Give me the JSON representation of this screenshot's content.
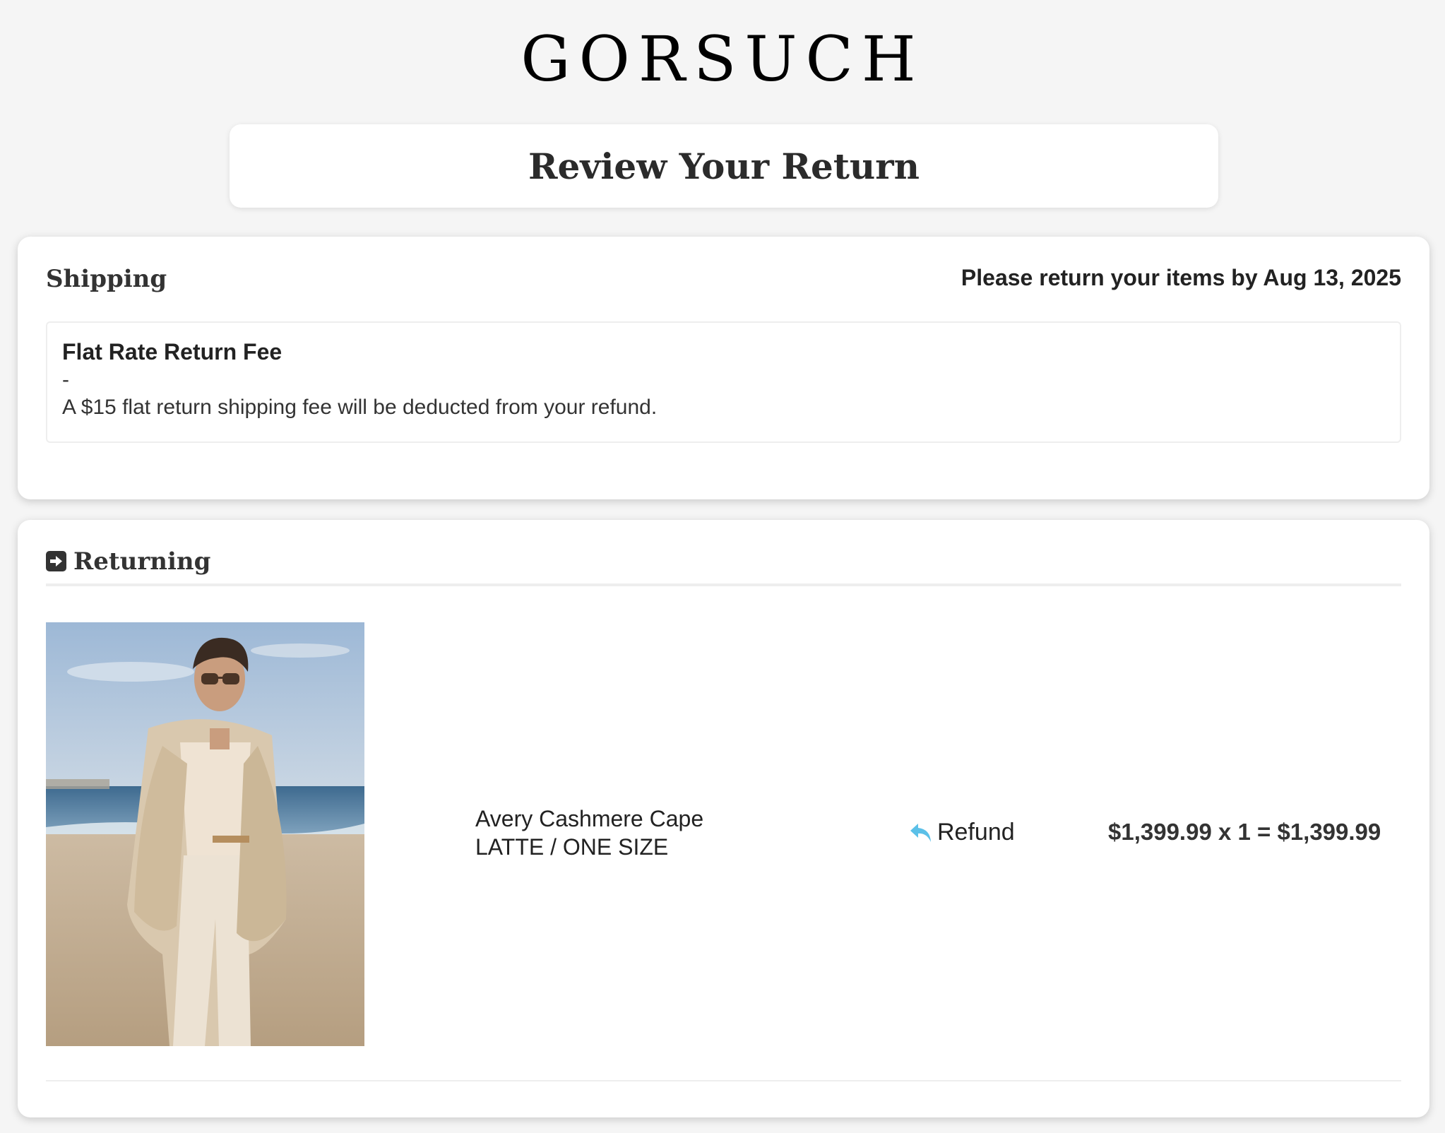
{
  "brand": {
    "logo_text": "GORSUCH"
  },
  "page": {
    "title": "Review Your Return"
  },
  "shipping": {
    "title": "Shipping",
    "return_by": "Please return your items by Aug 13, 2025",
    "fee": {
      "name": "Flat Rate Return Fee",
      "separator": "-",
      "description": "A $15 flat return shipping fee will be deducted from your refund."
    }
  },
  "returning": {
    "title": "Returning",
    "icon": "sign-in-icon",
    "items": [
      {
        "name": "Avery Cashmere Cape",
        "variant": "LATTE / ONE SIZE",
        "action_icon": "reply-icon",
        "action_label": "Refund",
        "price_line": "$1,399.99 x 1 = $1,399.99"
      }
    ]
  },
  "colors": {
    "accent_icon": "#5bc0e8",
    "text_dark": "#222222",
    "background": "#f5f5f5",
    "card": "#ffffff"
  }
}
